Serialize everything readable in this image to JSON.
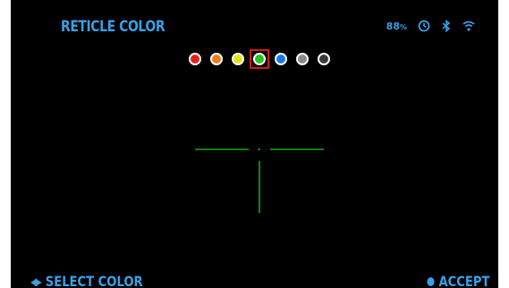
{
  "header": {
    "title": "RETICLE COLOR",
    "battery_value": "88",
    "battery_unit": "%",
    "status_icons": [
      "timer-icon",
      "bluetooth-icon",
      "wifi-icon"
    ]
  },
  "palette": {
    "colors": [
      {
        "name": "red",
        "hex": "#e8201c"
      },
      {
        "name": "orange",
        "hex": "#f27b1a"
      },
      {
        "name": "yellow",
        "hex": "#e4e21a"
      },
      {
        "name": "green",
        "hex": "#1ec81e"
      },
      {
        "name": "blue",
        "hex": "#1a78e6"
      },
      {
        "name": "gray",
        "hex": "#8a8a8a"
      },
      {
        "name": "dark-gray",
        "hex": "#3a3a3a"
      }
    ],
    "selected_index": 3,
    "selection_border": "#d01a1a"
  },
  "reticle": {
    "color": "#1aa81a"
  },
  "footer": {
    "select_label": "SELECT COLOR",
    "accept_label": "ACCEPT"
  },
  "theme": {
    "accent": "#3a9ee3",
    "background": "#000000"
  }
}
